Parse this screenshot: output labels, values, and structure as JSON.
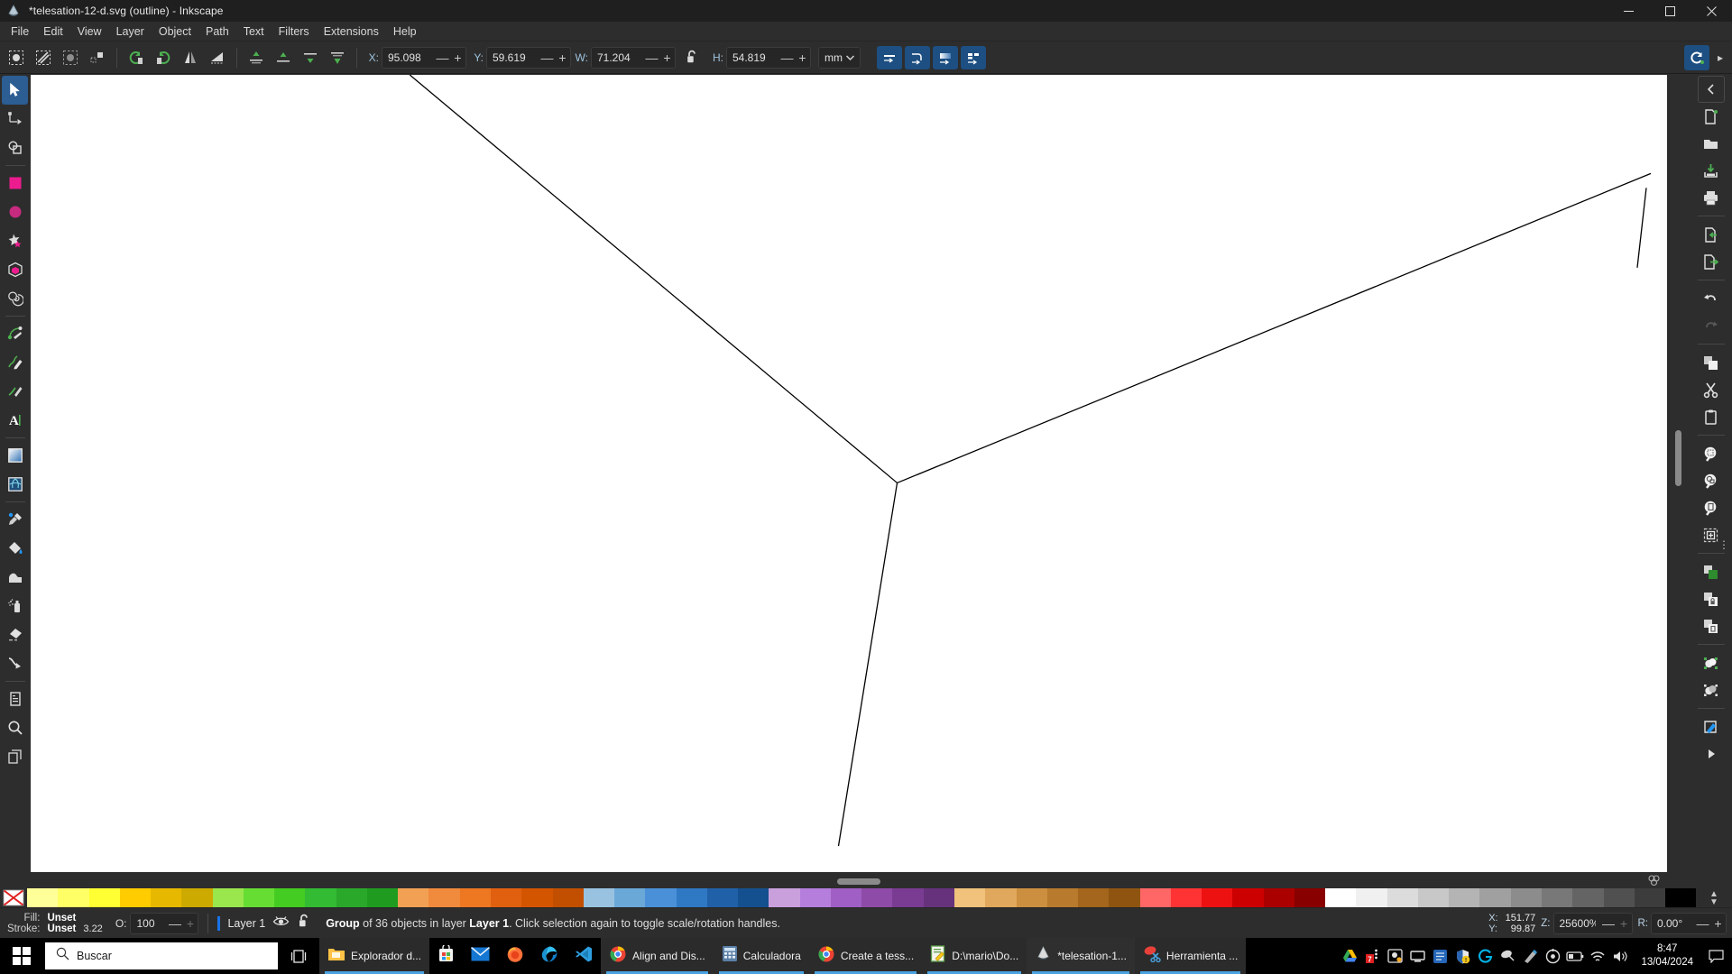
{
  "window": {
    "title": "*telesation-12-d.svg (outline) - Inkscape",
    "icon": "inkscape-icon",
    "minimize": "minimize-button",
    "maximize": "maximize-button",
    "close": "close-button"
  },
  "menubar": {
    "items": [
      {
        "label": "File"
      },
      {
        "label": "Edit"
      },
      {
        "label": "View"
      },
      {
        "label": "Layer"
      },
      {
        "label": "Object"
      },
      {
        "label": "Path"
      },
      {
        "label": "Text"
      },
      {
        "label": "Filters"
      },
      {
        "label": "Extensions"
      },
      {
        "label": "Help"
      }
    ]
  },
  "toolbar": {
    "select_all": "select-all-icon",
    "select_all_layers": "select-all-in-all-layers-icon",
    "deselect": "deselect-icon",
    "select_same": "select-same-icon",
    "rotate_ccw": "rotate-90-ccw-icon",
    "rotate_cw": "rotate-90-cw-icon",
    "flip_h": "flip-horizontal-icon",
    "flip_v": "flip-vertical-icon",
    "raise_top": "raise-to-top-icon",
    "raise": "raise-icon",
    "lower": "lower-icon",
    "lower_bottom": "lower-to-bottom-icon",
    "fields": [
      {
        "name": "x",
        "label": "X:",
        "value": "95.098"
      },
      {
        "name": "y",
        "label": "Y:",
        "value": "59.619"
      },
      {
        "name": "w",
        "label": "W:",
        "value": "71.204"
      },
      {
        "name": "h",
        "label": "H:",
        "value": "54.819"
      }
    ],
    "lock_ratio": "unlocked-icon",
    "unit": "mm",
    "minus": "—",
    "plus": "+",
    "snap_buttons": [
      {
        "name": "snap-scale-stroke",
        "icon": "scale-stroke-icon"
      },
      {
        "name": "snap-scale-corners",
        "icon": "scale-corners-icon"
      },
      {
        "name": "snap-transform-gradients",
        "icon": "transform-gradients-icon"
      },
      {
        "name": "snap-transform-patterns",
        "icon": "transform-patterns-icon"
      }
    ],
    "snap_toggle": "snap-enable-icon",
    "overflow": "toolbar-overflow-icon"
  },
  "toolbox": {
    "tools": [
      {
        "name": "selector-tool",
        "icon": "arrow-cursor-icon",
        "active": true
      },
      {
        "name": "node-tool",
        "icon": "node-editor-icon",
        "active": false
      },
      {
        "name": "boolean-tool",
        "icon": "boolean-ops-icon",
        "active": false
      },
      {
        "name": "rectangle-tool",
        "icon": "rectangle-icon",
        "active": false
      },
      {
        "name": "ellipse-tool",
        "icon": "ellipse-icon",
        "active": false
      },
      {
        "name": "star-tool",
        "icon": "star-icon",
        "active": false
      },
      {
        "name": "3dbox-tool",
        "icon": "cube-icon",
        "active": false
      },
      {
        "name": "spiral-tool",
        "icon": "spiral-icon",
        "active": false
      },
      {
        "name": "pen-tool",
        "icon": "bezier-pen-icon",
        "active": false
      },
      {
        "name": "pencil-tool",
        "icon": "pencil-icon",
        "active": false
      },
      {
        "name": "calligraphy-tool",
        "icon": "calligraphy-brush-icon",
        "active": false
      },
      {
        "name": "text-tool",
        "icon": "text-a-icon",
        "active": false
      },
      {
        "name": "gradient-tool",
        "icon": "gradient-icon",
        "active": false
      },
      {
        "name": "mesh-tool",
        "icon": "mesh-gradient-icon",
        "active": false
      },
      {
        "name": "dropper-tool",
        "icon": "eyedropper-icon",
        "active": false
      },
      {
        "name": "paintbucket-tool",
        "icon": "paint-bucket-icon",
        "active": false
      },
      {
        "name": "tweak-tool",
        "icon": "tweak-icon",
        "active": false
      },
      {
        "name": "spray-tool",
        "icon": "spray-can-icon",
        "active": false
      },
      {
        "name": "eraser-tool",
        "icon": "eraser-icon",
        "active": false
      },
      {
        "name": "connector-tool",
        "icon": "connector-icon",
        "active": false
      },
      {
        "name": "lpe-tool",
        "icon": "page-tool-icon",
        "active": false
      },
      {
        "name": "zoom-tool",
        "icon": "magnifier-icon",
        "active": false
      },
      {
        "name": "measure-tool",
        "icon": "measure-icon",
        "active": false
      }
    ]
  },
  "rightbar": {
    "collapse": "chevron-left-icon",
    "buttons": [
      {
        "name": "new-document",
        "icon": "new-file-icon"
      },
      {
        "name": "open-document",
        "icon": "open-folder-icon"
      },
      {
        "name": "save-document",
        "icon": "save-icon"
      },
      {
        "name": "print-document",
        "icon": "printer-icon"
      },
      {
        "name": "import",
        "icon": "import-icon"
      },
      {
        "name": "export",
        "icon": "export-icon"
      },
      {
        "name": "undo",
        "icon": "undo-arrow-icon"
      },
      {
        "name": "redo",
        "icon": "redo-arrow-icon",
        "disabled": true
      },
      {
        "name": "duplicate",
        "icon": "copy-icon"
      },
      {
        "name": "cut",
        "icon": "scissors-icon"
      },
      {
        "name": "paste",
        "icon": "clipboard-icon"
      },
      {
        "name": "zoom-selection",
        "icon": "zoom-selection-icon"
      },
      {
        "name": "zoom-drawing",
        "icon": "zoom-drawing-icon"
      },
      {
        "name": "zoom-page",
        "icon": "zoom-page-icon"
      },
      {
        "name": "zoom-center",
        "icon": "zoom-center-icon"
      },
      {
        "name": "fill-and-stroke",
        "icon": "fill-stroke-icon"
      },
      {
        "name": "group-objects",
        "icon": "group-icon"
      },
      {
        "name": "ungroup-objects",
        "icon": "ungroup-icon"
      },
      {
        "name": "union-path",
        "icon": "path-union-icon"
      },
      {
        "name": "difference-path",
        "icon": "path-difference-icon"
      },
      {
        "name": "object-properties",
        "icon": "object-properties-icon"
      },
      {
        "name": "expand-panel",
        "icon": "triangle-right-icon"
      }
    ]
  },
  "canvas": {
    "background": "#ffffff",
    "stroke_color": "#000000",
    "paths": [
      "M 446,75 L 985,530",
      "M 985,530 L 1800,230",
      "M 985,530 L 920,935",
      "M 1790,243 L 1782,325"
    ],
    "scroll_v_thumb": "vertical-scrollbar-thumb",
    "scroll_h_thumb": "horizontal-scrollbar-thumb",
    "corner_icon": "canvas-settings-icon"
  },
  "palette": {
    "no_color": "no-color-x-icon",
    "scroll_up": "▲",
    "scroll_down": "▼",
    "colors": [
      "#ffff99",
      "#ffff66",
      "#ffff33",
      "#ffcc00",
      "#e6b800",
      "#ccaa00",
      "#99e64d",
      "#66dd33",
      "#44cc22",
      "#33bb33",
      "#2aa82a",
      "#1f9c1f",
      "#f2a154",
      "#f08a3c",
      "#ee7722",
      "#e06010",
      "#d45500",
      "#c24f00",
      "#99c2e0",
      "#6aa8d8",
      "#4a90d9",
      "#2f78c4",
      "#2060a8",
      "#14508f",
      "#c9a0dc",
      "#b57edc",
      "#a05fc4",
      "#8e4ba8",
      "#7a3c93",
      "#66327c",
      "#f0c27b",
      "#e0a85c",
      "#cc8f3f",
      "#b87a2c",
      "#a3661c",
      "#8f5510",
      "#ff6666",
      "#ff3333",
      "#ee1111",
      "#cc0000",
      "#aa0000",
      "#880000",
      "#ffffff",
      "#f0f0f0",
      "#dcdcdc",
      "#c8c8c8",
      "#b4b4b4",
      "#a0a0a0",
      "#8c8c8c",
      "#787878",
      "#646464",
      "#505050",
      "#3c3c3c",
      "#000000"
    ]
  },
  "statusbar": {
    "fill_label": "Fill:",
    "fill_value": "Unset",
    "stroke_label": "Stroke:",
    "stroke_value": "Unset",
    "stroke_width": "3.22",
    "opacity_label": "O:",
    "opacity_value": "100",
    "layer_name": "Layer 1",
    "layer_visibility": "eye-icon",
    "layer_lock": "unlock-icon",
    "message_prefix": "Group",
    "message_mid": " of 36 objects in layer ",
    "message_layer": "Layer 1",
    "message_suffix": ". Click selection again to toggle scale/rotation handles.",
    "cursor_x_label": "X:",
    "cursor_x_value": "151.77",
    "cursor_y_label": "Y:",
    "cursor_y_value": "99.87",
    "zoom_label": "Z:",
    "zoom_value": "25600%",
    "rotation_label": "R:",
    "rotation_value": "0.00°"
  },
  "taskbar": {
    "start": "windows-start-icon",
    "search_placeholder": "Buscar",
    "search_icon": "search-icon",
    "task_view": "task-view-icon",
    "items": [
      {
        "name": "file-explorer",
        "label": "Explorador d...",
        "icon": "folder-icon",
        "active": true,
        "pinned": false
      },
      {
        "name": "microsoft-store",
        "label": "",
        "icon": "store-icon",
        "active": false,
        "pinned": true
      },
      {
        "name": "mail",
        "label": "",
        "icon": "mail-icon",
        "active": false,
        "pinned": true
      },
      {
        "name": "firefox",
        "label": "",
        "icon": "firefox-icon",
        "active": false,
        "pinned": true
      },
      {
        "name": "edge",
        "label": "",
        "icon": "edge-icon",
        "active": false,
        "pinned": true
      },
      {
        "name": "vscode",
        "label": "",
        "icon": "vscode-icon",
        "active": false,
        "pinned": true
      },
      {
        "name": "chrome-align",
        "label": "Align and Dis...",
        "icon": "chrome-icon",
        "active": true,
        "pinned": false
      },
      {
        "name": "calculator",
        "label": "Calculadora",
        "icon": "calculator-icon",
        "active": true,
        "pinned": false
      },
      {
        "name": "chrome-tess",
        "label": "Create a tess...",
        "icon": "chrome-icon",
        "active": true,
        "pinned": false
      },
      {
        "name": "notepad-docs",
        "label": "D:\\mario\\Do...",
        "icon": "notepad-icon",
        "active": true,
        "pinned": false
      },
      {
        "name": "inkscape",
        "label": "*telesation-1...",
        "icon": "inkscape-icon",
        "active": true,
        "pinned": false,
        "focused": true
      },
      {
        "name": "snipping-tool",
        "label": "Herramienta ...",
        "icon": "snip-icon",
        "active": true,
        "pinned": false
      }
    ],
    "tray": [
      {
        "name": "google-drive-tray",
        "icon": "drive-icon"
      },
      {
        "name": "calendar-tray",
        "icon": "calendar-7-icon"
      },
      {
        "name": "screen-tray",
        "icon": "screen-icon"
      },
      {
        "name": "display-tray",
        "icon": "monitor-icon"
      },
      {
        "name": "app-tray",
        "icon": "blue-app-icon"
      },
      {
        "name": "security-tray",
        "icon": "shield-warning-icon"
      },
      {
        "name": "logitech-tray",
        "icon": "logitech-g-icon"
      },
      {
        "name": "snip-tray",
        "icon": "snip-tool-icon"
      },
      {
        "name": "pen-tray",
        "icon": "pen-icon"
      },
      {
        "name": "settings-tray",
        "icon": "gear-disc-icon"
      },
      {
        "name": "battery-tray",
        "icon": "battery-icon"
      },
      {
        "name": "network-tray",
        "icon": "wifi-icon"
      },
      {
        "name": "volume-tray",
        "icon": "speaker-icon"
      }
    ],
    "clock_time": "8:47",
    "clock_date": "13/04/2024",
    "notifications": "notification-icon"
  }
}
